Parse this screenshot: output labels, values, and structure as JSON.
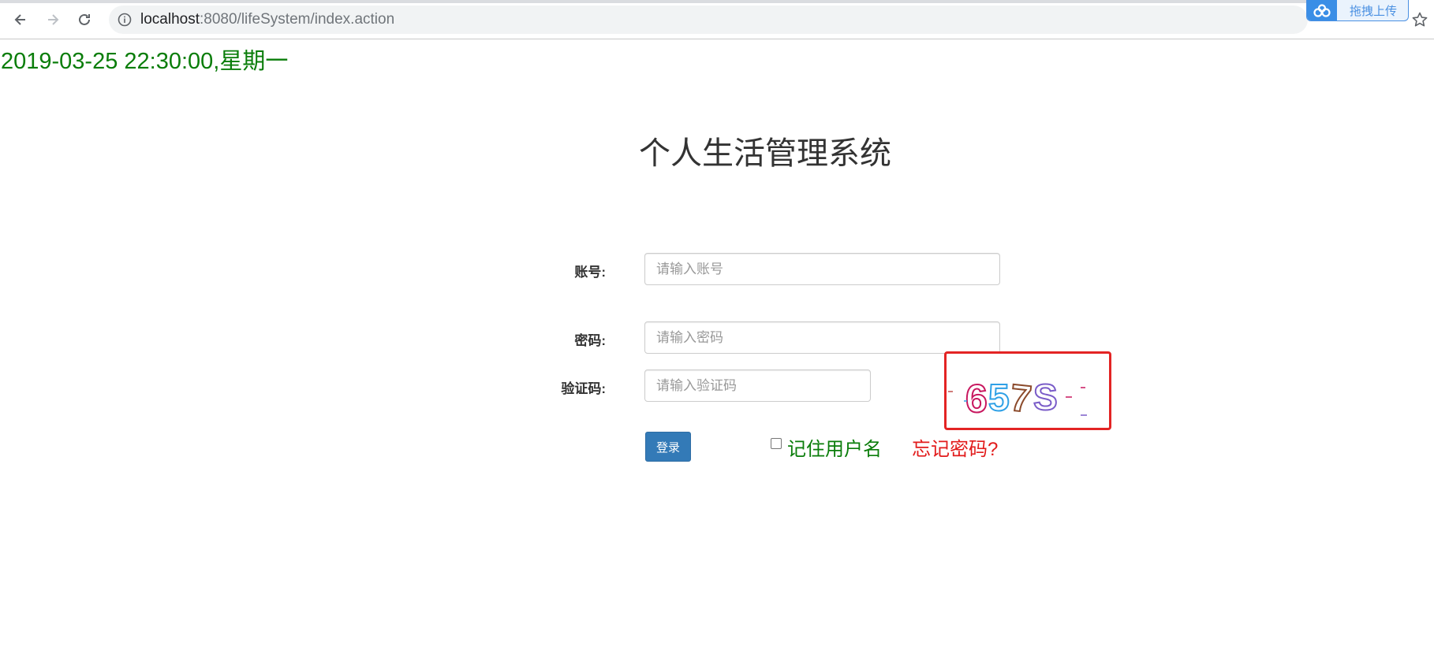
{
  "browser": {
    "url_host": "localhost",
    "url_rest": ":8080/lifeSystem/index.action",
    "upload_widget_label": "拖拽上传",
    "icons": [
      "back-icon",
      "forward-icon",
      "reload-icon",
      "info-icon",
      "star-icon",
      "cloud-icon"
    ]
  },
  "page": {
    "datetime": "2019-03-25 22:30:00,星期一",
    "title": "个人生活管理系统",
    "form": {
      "account_label": "账号:",
      "account_placeholder": "请输入账号",
      "account_value": "",
      "password_label": "密码:",
      "password_placeholder": "请输入密码",
      "password_value": "",
      "captcha_label": "验证码:",
      "captcha_placeholder": "请输入验证码",
      "captcha_value": "",
      "captcha_text": "657S",
      "login_button": "登录",
      "remember_label": "记住用户名",
      "remember_checked": false,
      "forgot_link": "忘记密码?"
    }
  },
  "colors": {
    "datetime": "#0a7d0a",
    "remember": "#0a7d0a",
    "forgot": "#e21b1b",
    "login_button": "#337ab7",
    "captcha_border": "#e32424"
  }
}
